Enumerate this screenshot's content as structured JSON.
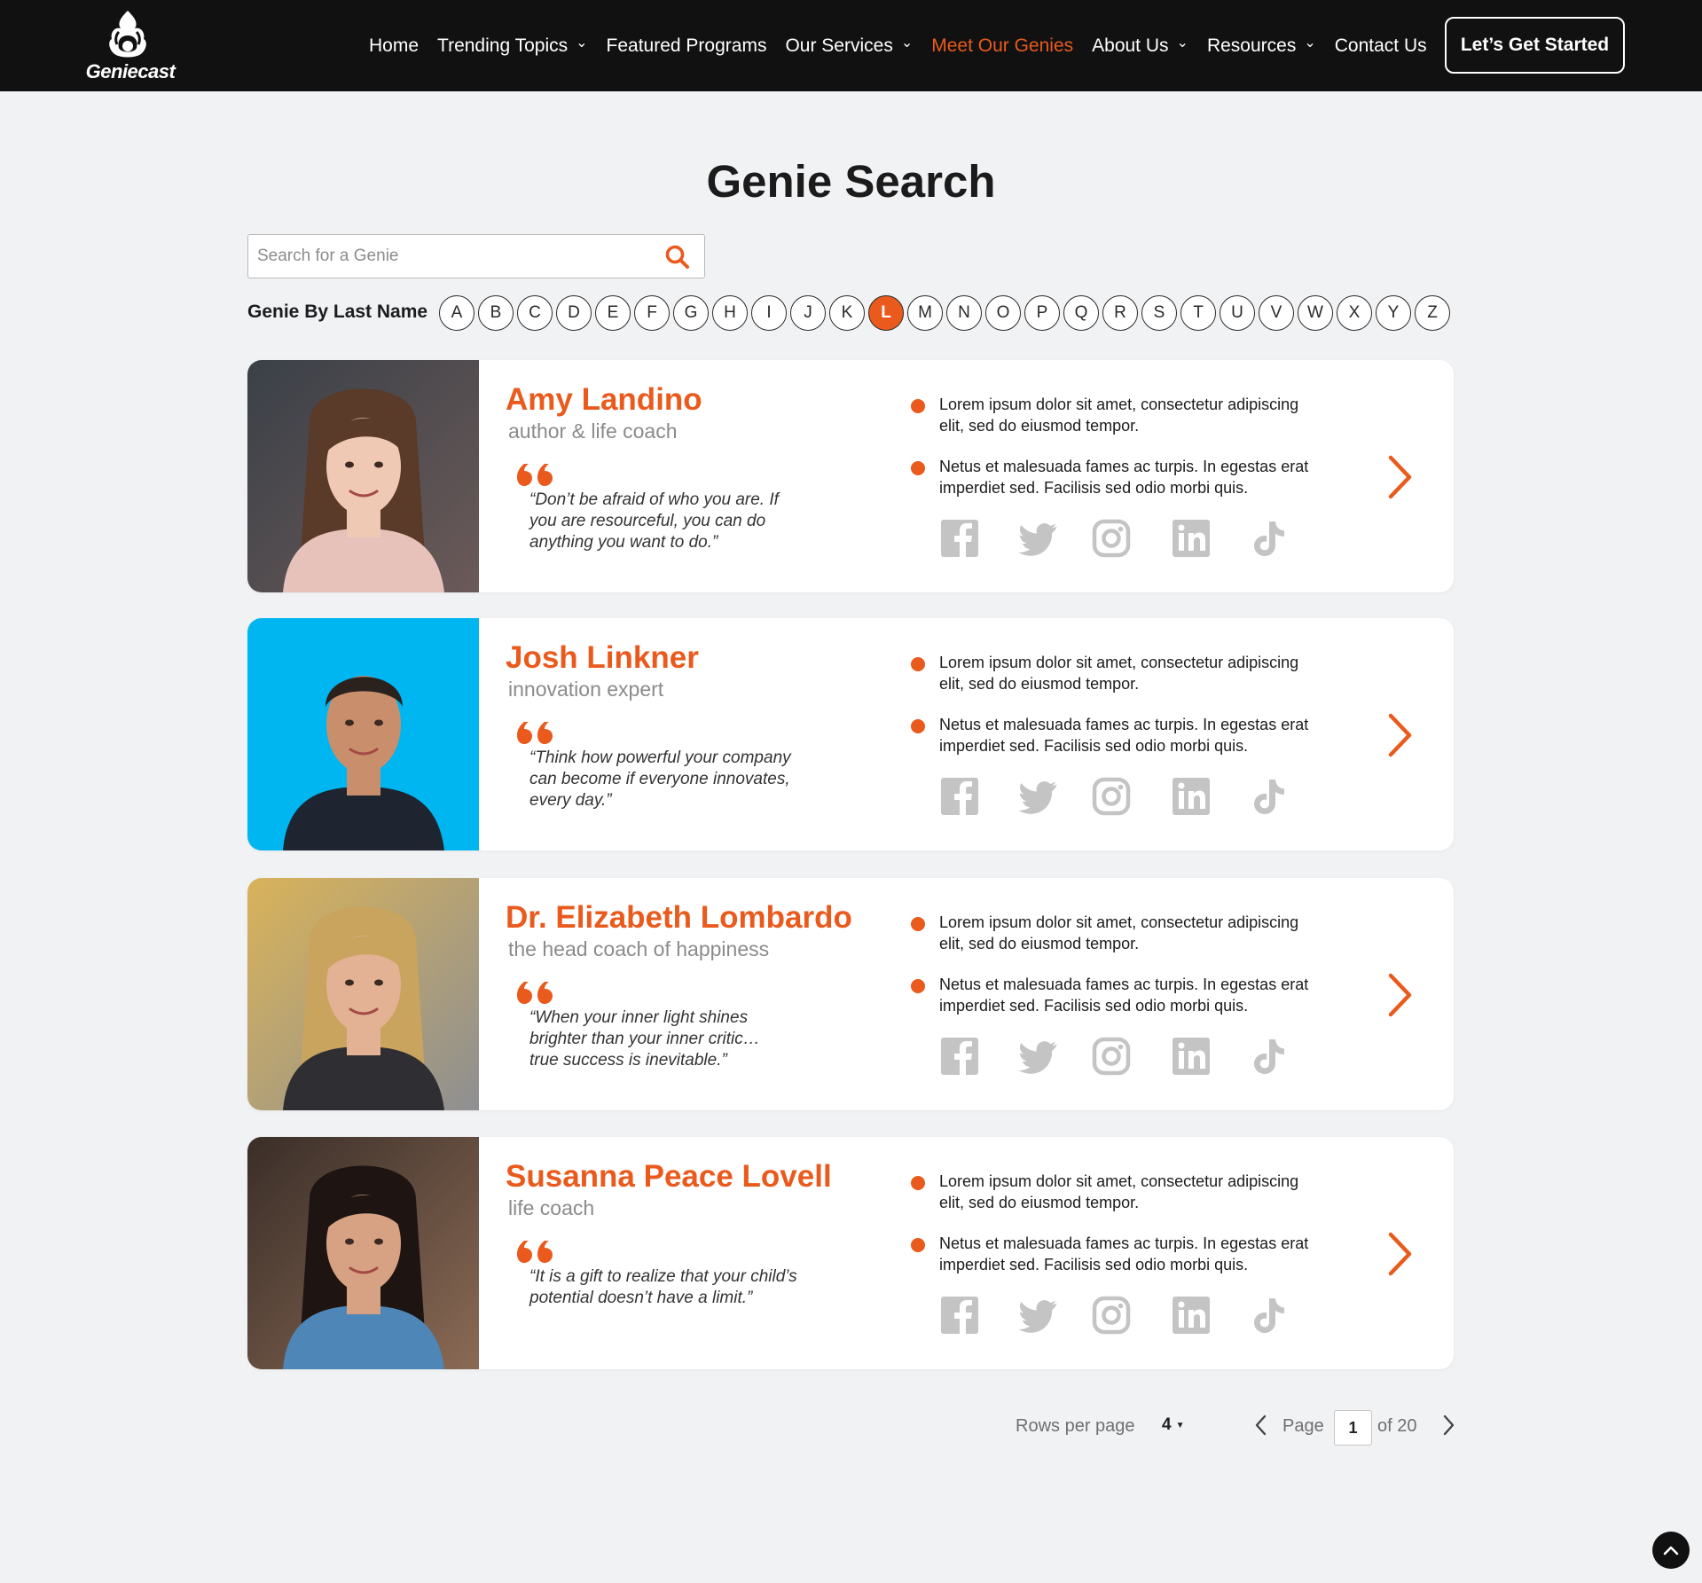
{
  "brand": {
    "name": "Geniecast"
  },
  "nav": {
    "items": [
      {
        "label": "Home",
        "dropdown": false,
        "active": false
      },
      {
        "label": "Trending Topics",
        "dropdown": true,
        "active": false
      },
      {
        "label": "Featured Programs",
        "dropdown": false,
        "active": false
      },
      {
        "label": "Our Services",
        "dropdown": true,
        "active": false
      },
      {
        "label": "Meet Our Genies",
        "dropdown": false,
        "active": true
      },
      {
        "label": "About Us",
        "dropdown": true,
        "active": false
      },
      {
        "label": "Resources",
        "dropdown": true,
        "active": false
      },
      {
        "label": "Contact Us",
        "dropdown": false,
        "active": false
      }
    ],
    "cta_label": "Let’s Get Started"
  },
  "page": {
    "title": "Genie Search"
  },
  "search": {
    "placeholder": "Search for a Genie",
    "value": ""
  },
  "alphabet": {
    "label": "Genie By Last Name",
    "letters": [
      "A",
      "B",
      "C",
      "D",
      "E",
      "F",
      "G",
      "H",
      "I",
      "J",
      "K",
      "L",
      "M",
      "N",
      "O",
      "P",
      "Q",
      "R",
      "S",
      "T",
      "U",
      "V",
      "W",
      "X",
      "Y",
      "Z"
    ],
    "active": "L"
  },
  "genies": [
    {
      "name": "Amy Landino",
      "title": "author & life coach",
      "quote": "“Don’t be afraid of who you are. If\nyou are resourceful, you can do\nanything you want to do.”",
      "bullets": [
        "Lorem ipsum dolor sit amet, consectetur adipiscing elit, sed do eiusmod tempor.",
        "Netus et malesuada fames ac turpis. In egestas erat imperdiet sed. Facilisis sed odio morbi quis."
      ]
    },
    {
      "name": "Josh Linkner",
      "title": "innovation expert",
      "quote": "“Think how powerful your company\ncan become if everyone innovates,\nevery day.”",
      "bullets": [
        "Lorem ipsum dolor sit amet, consectetur adipiscing elit, sed do eiusmod tempor.",
        "Netus et malesuada fames ac turpis. In egestas erat imperdiet sed. Facilisis sed odio morbi quis."
      ]
    },
    {
      "name": "Dr. Elizabeth Lombardo",
      "title": "the head coach of happiness",
      "quote": "“When your inner light shines\n    brighter than your inner critic…\n      true success is inevitable.”",
      "bullets": [
        "Lorem ipsum dolor sit amet, consectetur adipiscing elit, sed do eiusmod tempor.",
        "Netus et malesuada fames ac turpis. In egestas erat imperdiet sed. Facilisis sed odio morbi quis."
      ]
    },
    {
      "name": "Susanna Peace Lovell",
      "title": "life coach",
      "quote": "“It is a gift to realize that your child’s\npotential doesn’t have a limit.”",
      "bullets": [
        "Lorem ipsum dolor sit amet, consectetur adipiscing elit, sed do eiusmod tempor.",
        "Netus et malesuada fames ac turpis. In egestas erat imperdiet sed. Facilisis sed odio morbi quis."
      ]
    }
  ],
  "social_icons": [
    "facebook-icon",
    "twitter-icon",
    "instagram-icon",
    "linkedin-icon",
    "tiktok-icon"
  ],
  "pagination": {
    "rows_label": "Rows per page",
    "rows_value": "4",
    "page_label": "Page",
    "current_page": "1",
    "total_label": "of 20"
  },
  "colors": {
    "accent": "#ea5a1d",
    "header_bg": "#111111",
    "page_bg": "#f1f2f4",
    "icon_gray": "#c4c4c4"
  }
}
